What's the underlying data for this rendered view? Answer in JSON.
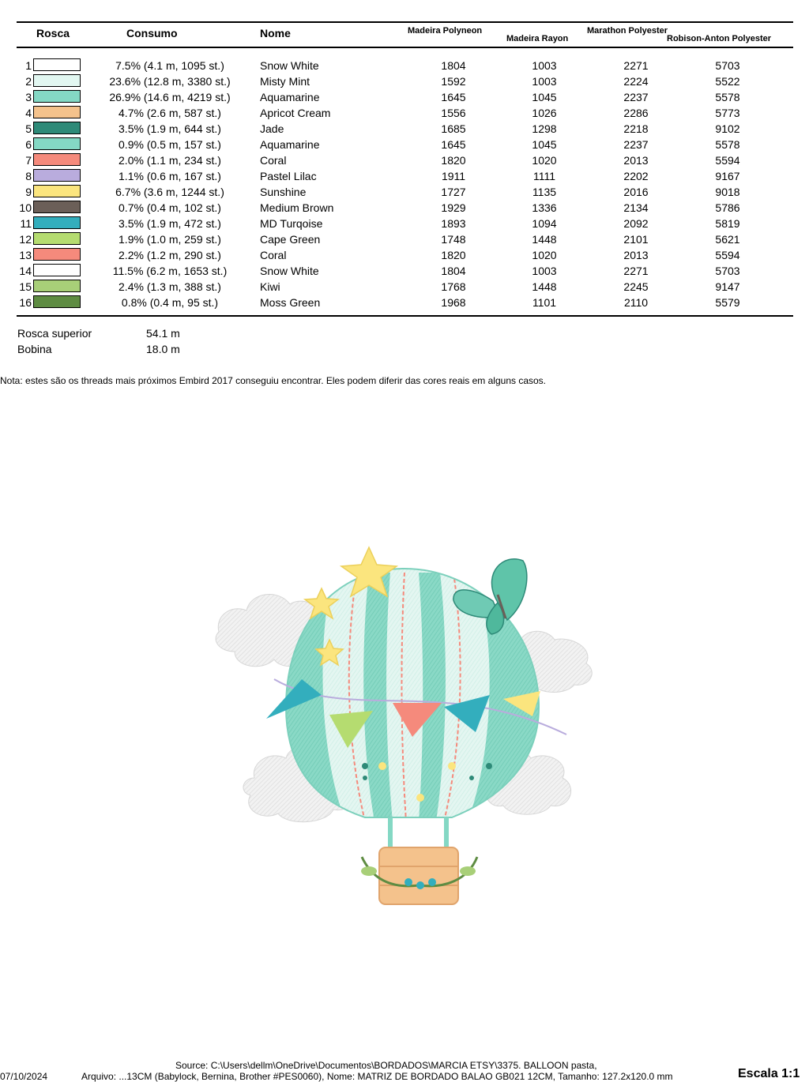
{
  "table": {
    "headers": {
      "rosca": "Rosca",
      "consumo": "Consumo",
      "nome": "Nome",
      "madeira_polyneon": "Madeira Polyneon",
      "madeira_rayon": "Madeira Rayon",
      "marathon_polyester": "Marathon Polyester",
      "robison_anton_polyester": "Robison-Anton Polyester"
    },
    "rows": [
      {
        "n": "1",
        "color": "#ffffff",
        "consumo": "7.5% (4.1 m, 1095 st.)",
        "nome": "Snow White",
        "c1": "1804",
        "c2": "1003",
        "c3": "2271",
        "c4": "5703"
      },
      {
        "n": "2",
        "color": "#e2f7f1",
        "consumo": "23.6% (12.8 m, 3380 st.)",
        "nome": "Misty Mint",
        "c1": "1592",
        "c2": "1003",
        "c3": "2224",
        "c4": "5522"
      },
      {
        "n": "3",
        "color": "#84d8c4",
        "consumo": "26.9% (14.6 m, 4219 st.)",
        "nome": "Aquamarine",
        "c1": "1645",
        "c2": "1045",
        "c3": "2237",
        "c4": "5578"
      },
      {
        "n": "4",
        "color": "#f4c28c",
        "consumo": "4.7% (2.6 m, 587 st.)",
        "nome": "Apricot Cream",
        "c1": "1556",
        "c2": "1026",
        "c3": "2286",
        "c4": "5773"
      },
      {
        "n": "5",
        "color": "#2e8a78",
        "consumo": "3.5% (1.9 m, 644 st.)",
        "nome": "Jade",
        "c1": "1685",
        "c2": "1298",
        "c3": "2218",
        "c4": "9102"
      },
      {
        "n": "6",
        "color": "#84d8c4",
        "consumo": "0.9% (0.5 m, 157 st.)",
        "nome": "Aquamarine",
        "c1": "1645",
        "c2": "1045",
        "c3": "2237",
        "c4": "5578"
      },
      {
        "n": "7",
        "color": "#f58a7c",
        "consumo": "2.0% (1.1 m, 234 st.)",
        "nome": "Coral",
        "c1": "1820",
        "c2": "1020",
        "c3": "2013",
        "c4": "5594"
      },
      {
        "n": "8",
        "color": "#b9acdd",
        "consumo": "1.1% (0.6 m, 167 st.)",
        "nome": "Pastel Lilac",
        "c1": "1911",
        "c2": "1111",
        "c3": "2202",
        "c4": "9167"
      },
      {
        "n": "9",
        "color": "#fbe57e",
        "consumo": "6.7% (3.6 m, 1244 st.)",
        "nome": "Sunshine",
        "c1": "1727",
        "c2": "1135",
        "c3": "2016",
        "c4": "9018"
      },
      {
        "n": "10",
        "color": "#6b5f58",
        "consumo": "0.7% (0.4 m, 102 st.)",
        "nome": "Medium Brown",
        "c1": "1929",
        "c2": "1336",
        "c3": "2134",
        "c4": "5786"
      },
      {
        "n": "11",
        "color": "#33aebd",
        "consumo": "3.5% (1.9 m, 472 st.)",
        "nome": "MD Turqoise",
        "c1": "1893",
        "c2": "1094",
        "c3": "2092",
        "c4": "5819"
      },
      {
        "n": "12",
        "color": "#b5dc70",
        "consumo": "1.9% (1.0 m, 259 st.)",
        "nome": "Cape Green",
        "c1": "1748",
        "c2": "1448",
        "c3": "2101",
        "c4": "5621"
      },
      {
        "n": "13",
        "color": "#f58a7c",
        "consumo": "2.2% (1.2 m, 290 st.)",
        "nome": "Coral",
        "c1": "1820",
        "c2": "1020",
        "c3": "2013",
        "c4": "5594"
      },
      {
        "n": "14",
        "color": "#ffffff",
        "consumo": "11.5% (6.2 m, 1653 st.)",
        "nome": "Snow White",
        "c1": "1804",
        "c2": "1003",
        "c3": "2271",
        "c4": "5703"
      },
      {
        "n": "15",
        "color": "#a8cf78",
        "consumo": "2.4% (1.3 m, 388 st.)",
        "nome": "Kiwi",
        "c1": "1768",
        "c2": "1448",
        "c3": "2245",
        "c4": "9147"
      },
      {
        "n": "16",
        "color": "#5e8c42",
        "consumo": "0.8% (0.4 m, 95 st.)",
        "nome": "Moss Green",
        "c1": "1968",
        "c2": "1101",
        "c3": "2110",
        "c4": "5579"
      }
    ]
  },
  "summary": {
    "top_label": "Rosca superior",
    "top_value": "54.1 m",
    "bobbin_label": "Bobina",
    "bobbin_value": "18.0 m"
  },
  "note": "Nota: estes são os threads mais próximos Embird 2017 conseguiu encontrar. Eles podem diferir das cores reais em alguns casos.",
  "footer": {
    "date": "07/10/2024",
    "source": "Source: C:\\Users\\dellm\\OneDrive\\Documentos\\BORDADOS\\MARCIA ETSY\\3375. BALLOON pasta,",
    "file": "Arquivo: ...13CM (Babylock, Bernina, Brother #PES0060), Nome: MATRIZ DE BORDADO BALAO GB021 12CM, Tamanho: 127.2x120.0 mm",
    "scale": "Escala 1:1"
  },
  "colors": {
    "aquamarine": "#84d8c4",
    "misty_mint": "#e2f7f1",
    "coral": "#f58a7c",
    "sunshine": "#fbe57e",
    "turquoise": "#33aebd",
    "cape_green": "#b5dc70",
    "apricot": "#f4c28c",
    "jade": "#2e8a78",
    "lilac": "#b9acdd",
    "cloud": "#e9e9e9"
  }
}
